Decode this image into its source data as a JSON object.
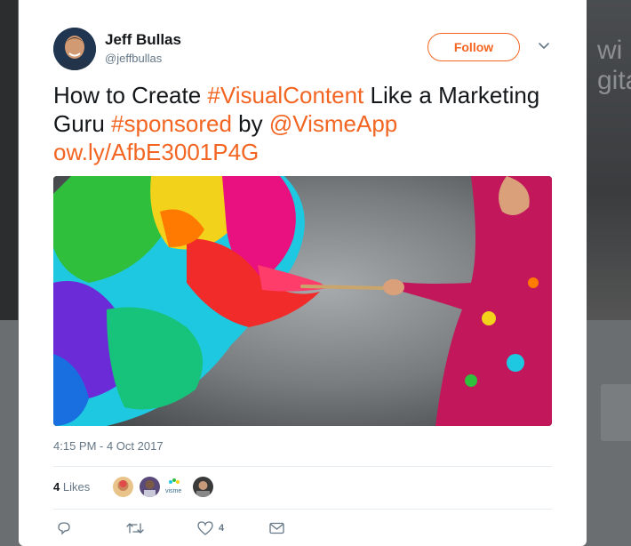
{
  "background": {
    "right_text": "wi\ngita"
  },
  "tweet": {
    "author_name": "Jeff Bullas",
    "author_handle": "@jeffbullas",
    "follow_label": "Follow",
    "text_parts": [
      {
        "text": "How to Create ",
        "highlight": false
      },
      {
        "text": "#VisualContent",
        "highlight": true
      },
      {
        "text": " Like a Marketing Guru   ",
        "highlight": false
      },
      {
        "text": "#sponsored",
        "highlight": true
      },
      {
        "text": " by ",
        "highlight": false
      },
      {
        "text": "@VismeApp",
        "highlight": true
      },
      {
        "text": " ",
        "highlight": false
      },
      {
        "text": "ow.ly/AfbE3001P4G",
        "highlight": true
      }
    ],
    "timestamp": "4:15 PM - 4 Oct 2017",
    "likes_count": "4",
    "likes_label": "Likes",
    "liker_badge_text": "visme",
    "actions": {
      "reply_count": "",
      "retweet_count": "",
      "like_count": "4",
      "dm_count": ""
    }
  },
  "colors": {
    "accent": "#f26522",
    "text_primary": "#14171a",
    "text_secondary": "#657786",
    "divider": "#e6ecf0"
  },
  "icons": {
    "more": "chevron-down-icon",
    "reply": "reply-icon",
    "retweet": "retweet-icon",
    "like": "heart-icon",
    "dm": "envelope-icon"
  }
}
